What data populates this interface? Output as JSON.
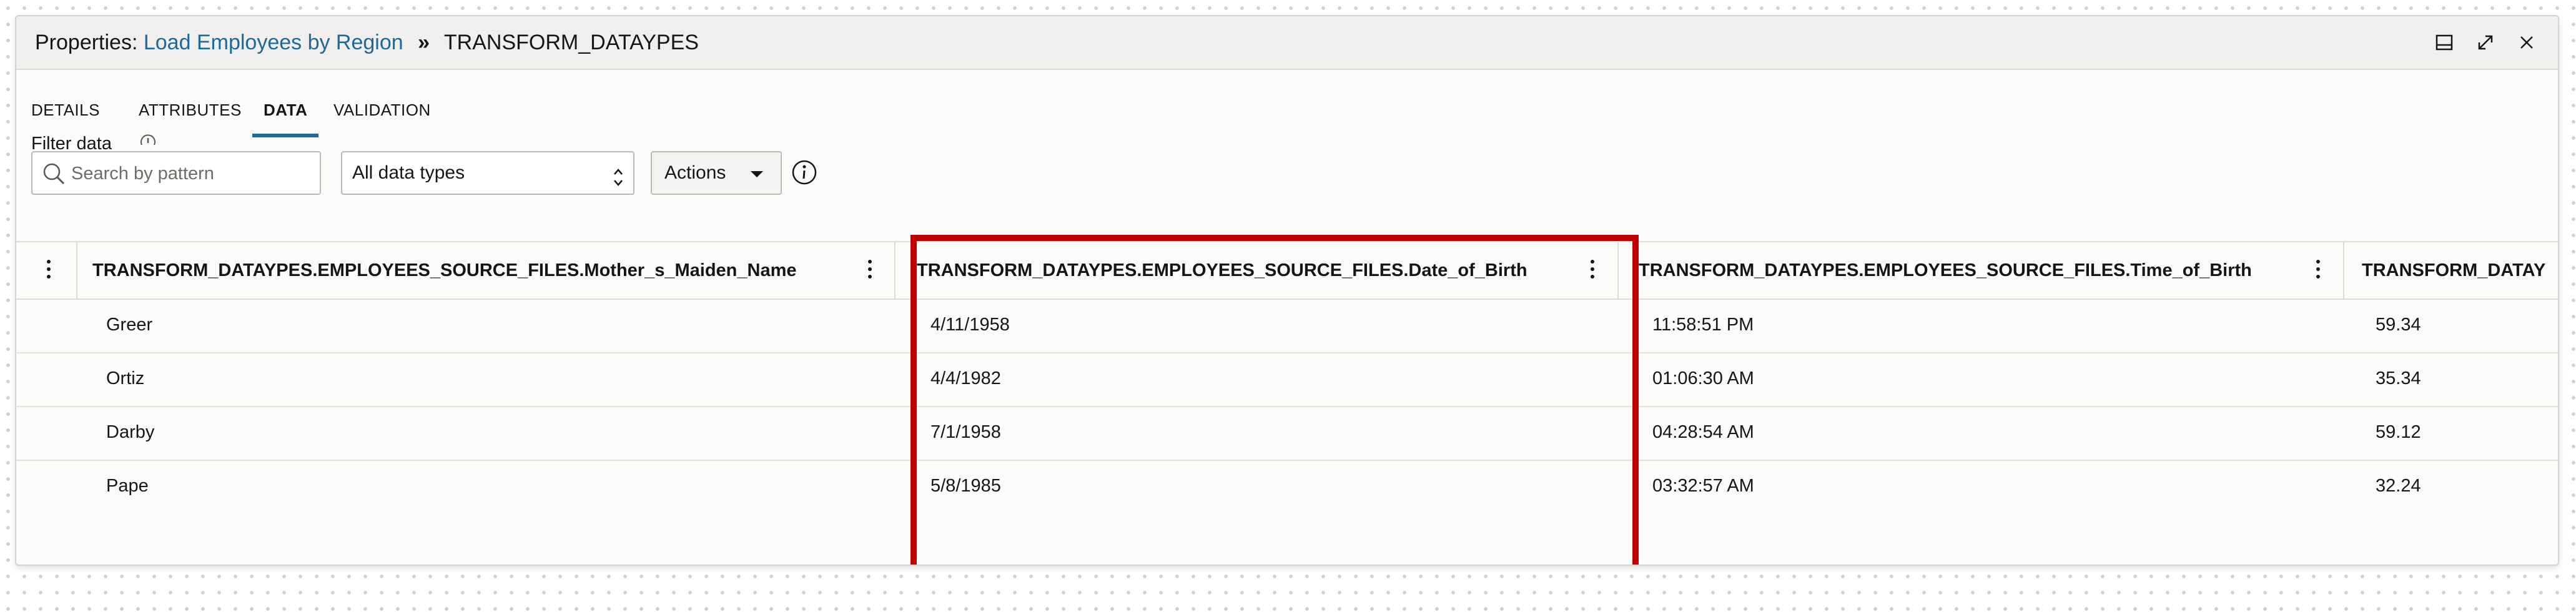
{
  "titlebar": {
    "prefix": "Properties:",
    "link": "Load Employees by Region",
    "separator": "»",
    "current": "TRANSFORM_DATAYPES"
  },
  "tabs": [
    {
      "label": "DETAILS",
      "active": false
    },
    {
      "label": "ATTRIBUTES",
      "active": false
    },
    {
      "label": "DATA",
      "active": true
    },
    {
      "label": "VALIDATION",
      "active": false
    }
  ],
  "filter": {
    "label": "Filter data",
    "search_placeholder": "Search by pattern",
    "datatype_selected": "All data types",
    "actions_label": "Actions"
  },
  "table": {
    "columns": [
      "TRANSFORM_DATAYPES.EMPLOYEES_SOURCE_FILES.Mother_s_Maiden_Name",
      "TRANSFORM_DATAYPES.EMPLOYEES_SOURCE_FILES.Date_of_Birth",
      "TRANSFORM_DATAYPES.EMPLOYEES_SOURCE_FILES.Time_of_Birth",
      "TRANSFORM_DATAY"
    ],
    "rows": [
      [
        "Greer",
        "4/11/1958",
        "11:58:51 PM",
        "59.34"
      ],
      [
        "Ortiz",
        "4/4/1982",
        "01:06:30 AM",
        "35.34"
      ],
      [
        "Darby",
        "7/1/1958",
        "04:28:54 AM",
        "59.12"
      ],
      [
        "Pape",
        "5/8/1985",
        "03:32:57 AM",
        "32.24"
      ]
    ]
  },
  "colors": {
    "accent": "#1b6a98",
    "highlight": "#c00000"
  }
}
